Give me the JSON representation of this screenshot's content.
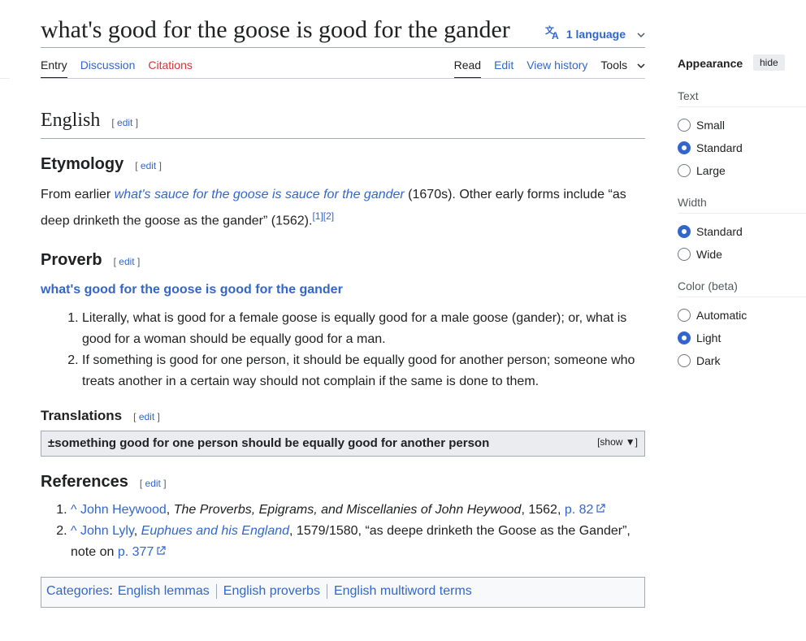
{
  "header": {
    "title": "what's good for the goose is good for the gander",
    "language_button": "1 language"
  },
  "tabs": {
    "left": [
      "Entry",
      "Discussion",
      "Citations"
    ],
    "right": [
      "Read",
      "Edit",
      "View history",
      "Tools"
    ]
  },
  "edit_label": "edit",
  "sections": {
    "english": "English",
    "etymology": "Etymology",
    "proverb": "Proverb",
    "translations": "Translations",
    "references": "References"
  },
  "etymology": {
    "prefix": "From earlier ",
    "link": "what's sauce for the goose is sauce for the gander",
    "mid": " (1670s). Other early forms include “as",
    "line2": "deep drinketh the goose as the gander” (1562).",
    "refs": "[1][2]"
  },
  "proverb": {
    "headword": "what's good for the goose is good for the gander",
    "senses": [
      "Literally, what is good for a female goose is equally good for a male goose (gander); or, what is good for a woman should be equally good for a man.",
      "If something is good for one person, it should be equally good for another person; someone who treats another in a certain way should not complain if the same is done to them."
    ]
  },
  "translations": {
    "gloss": "±something good for one person should be equally good for another person",
    "toggle": "[show ▼]"
  },
  "references": {
    "ref1": {
      "caret": "^ John Heywood",
      "sep": ", ",
      "work": "The Proverbs, Epigrams, and Miscellanies of John Heywood",
      "tail": ", 1562, ",
      "page": "p. 82"
    },
    "ref2": {
      "caret": "^ John Lyly",
      "sep": ", ",
      "work": "Euphues and his England",
      "tail": ", 1579/1580, “as deepe drinketh the Goose as the Gander”,",
      "note": "note on ",
      "page": "p. 377"
    }
  },
  "categories": {
    "label": "Categories",
    "items": [
      "English lemmas",
      "English proverbs",
      "English multiword terms"
    ]
  },
  "appearance": {
    "title": "Appearance",
    "hide": "hide",
    "text_label": "Text",
    "text_options": [
      "Small",
      "Standard",
      "Large"
    ],
    "text_selected": "Standard",
    "width_label": "Width",
    "width_options": [
      "Standard",
      "Wide"
    ],
    "width_selected": "Standard",
    "color_label": "Color (beta)",
    "color_options": [
      "Automatic",
      "Light",
      "Dark"
    ],
    "color_selected": "Light"
  },
  "colors": {
    "link": "#3366cc",
    "red_link": "#d73333",
    "text": "#202122"
  }
}
